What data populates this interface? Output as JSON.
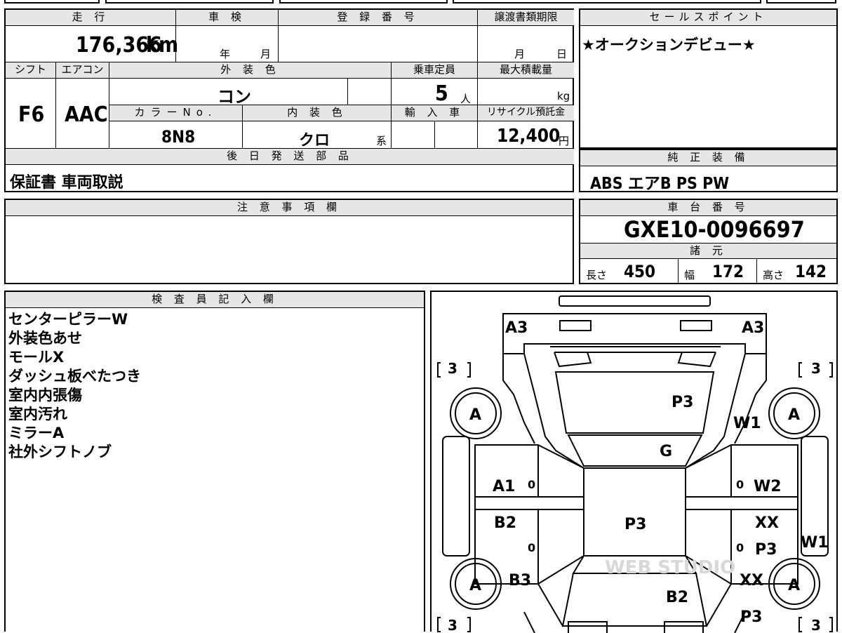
{
  "headers": {
    "mileage": "走 行",
    "inspection": "車 検",
    "registration": "登 録 番 号",
    "transfer_deadline": "譲渡書類期限",
    "sales_point": "セールスポイント",
    "shift": "シフト",
    "aircon": "エアコン",
    "exterior_color": "外 装 色",
    "capacity": "乗車定員",
    "max_load": "最大積載量",
    "color_no": "カラーNo.",
    "interior_color": "内 装 色",
    "import": "輸 入 車",
    "recycle": "リサイクル預託金",
    "later_parts": "後 日 発 送 部 品",
    "genuine_equipment": "純 正 装 備",
    "notes": "注 意 事 項 欄",
    "chassis_no": "車 台 番 号",
    "specs": "諸 元",
    "inspector": "検 査 員 記 入 欄"
  },
  "vehicle": {
    "mileage_value": "176,366",
    "mileage_unit": "km",
    "inspection_year_label": "年",
    "inspection_month_label": "月",
    "transfer_month_label": "月",
    "transfer_day_label": "日",
    "shift": "F6",
    "aircon": "AAC",
    "exterior_color": "コン",
    "capacity": "5",
    "capacity_unit": "人",
    "max_load_unit": "kg",
    "color_no": "8N8",
    "interior_color": "クロ",
    "interior_suffix": "系",
    "recycle_fee": "12,400",
    "recycle_unit": "円",
    "later_parts": "保証書 車両取説",
    "chassis_no": "GXE10-0096697"
  },
  "sales_point": "★オークションデビュー★",
  "equipment": "ABS エアB PS PW",
  "specs": {
    "length_label": "長さ",
    "length": "450",
    "width_label": "幅",
    "width": "172",
    "height_label": "高さ",
    "height": "142"
  },
  "inspector_notes": [
    "センターピラーW",
    "外装色あせ",
    "モールX",
    "ダッシュ板べたつき",
    "室内内張傷",
    "室内汚れ",
    "ミラーA",
    "社外シフトノブ"
  ],
  "diagram": {
    "tire_grade_tl": "3",
    "tire_grade_tr": "3",
    "tire_grade_bl": "3",
    "tire_grade_br": "3",
    "wheel_fl": "A",
    "wheel_fr": "A",
    "wheel_rl": "A",
    "wheel_rr": "A",
    "front_left": "A3",
    "front_right": "A3",
    "hood": "P3",
    "fender_right": "W1",
    "windshield": "G",
    "front_door_left": "A1",
    "front_door_right": "W2",
    "roof": "P3",
    "rear_door_left": "B2",
    "rear_door_right_1": "XX",
    "rear_door_right_2": "P3",
    "right_side": "W1",
    "rear_quarter_left": "B3",
    "rear_quarter_right_1": "XX",
    "trunk": "B2",
    "rear_quarter_right_2": "P3",
    "zero_1": "0",
    "zero_2": "0",
    "zero_3": "0",
    "zero_4": "0",
    "watermark": "WEB STUDIO"
  }
}
